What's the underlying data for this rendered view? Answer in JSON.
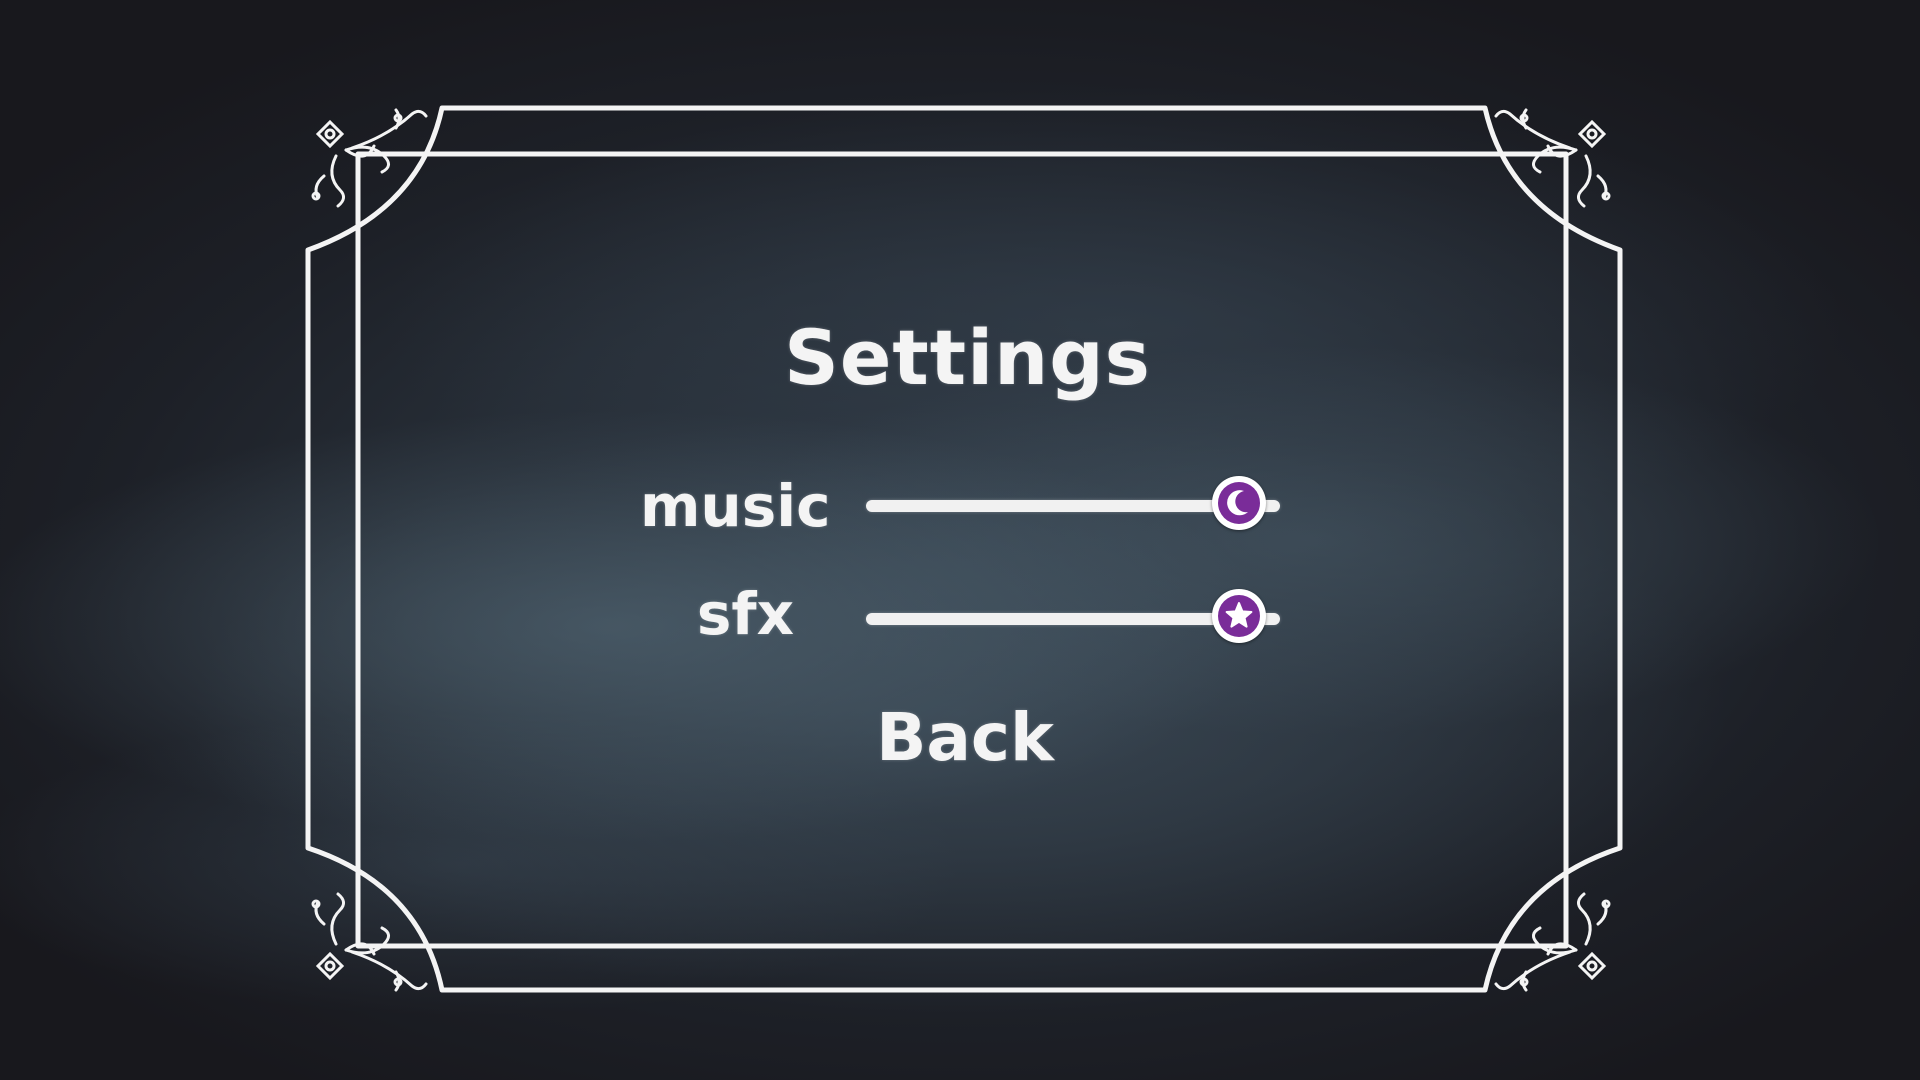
{
  "menu": {
    "title": "Settings",
    "back_label": "Back"
  },
  "settings": [
    {
      "id": "music",
      "label": "music",
      "level": 0.9,
      "knob_icon": "moon-icon"
    },
    {
      "id": "sfx",
      "label": "sfx",
      "level": 0.9,
      "knob_icon": "star-icon"
    }
  ],
  "colors": {
    "background": "#18181d",
    "chalkboard": "#2f3944",
    "frame": "#f4f4f4",
    "text": "#f4f4f4",
    "knob_accent": "#7a2c99"
  }
}
